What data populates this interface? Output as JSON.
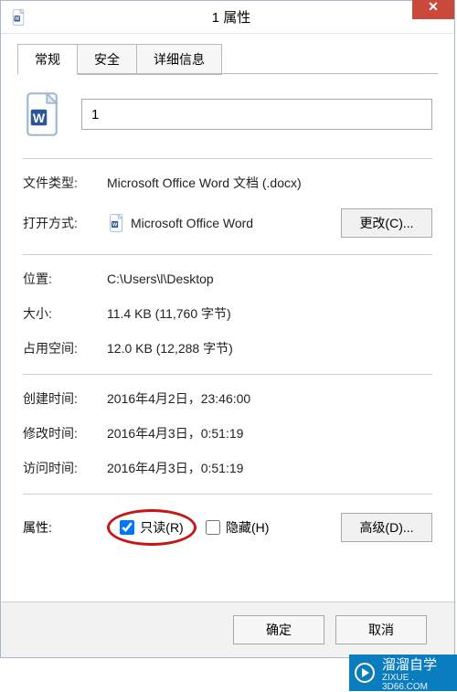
{
  "window": {
    "title": "1 属性",
    "close_icon_label": "✕"
  },
  "tabs": [
    {
      "label": "常规"
    },
    {
      "label": "安全"
    },
    {
      "label": "详细信息"
    }
  ],
  "general": {
    "filename": "1",
    "file_type_label": "文件类型:",
    "file_type": "Microsoft Office Word 文档 (.docx)",
    "opens_with_label": "打开方式:",
    "opens_with": "Microsoft Office Word",
    "change_button": "更改(C)...",
    "location_label": "位置:",
    "location": "C:\\Users\\l\\Desktop",
    "size_label": "大小:",
    "size": "11.4 KB (11,760 字节)",
    "size_on_disk_label": "占用空间:",
    "size_on_disk": "12.0 KB (12,288 字节)",
    "created_label": "创建时间:",
    "created": "2016年4月2日，23:46:00",
    "modified_label": "修改时间:",
    "modified": "2016年4月3日，0:51:19",
    "accessed_label": "访问时间:",
    "accessed": "2016年4月3日，0:51:19",
    "attributes_label": "属性:",
    "readonly_label": "只读(R)",
    "readonly_checked": true,
    "hidden_label": "隐藏(H)",
    "hidden_checked": false,
    "advanced_button": "高级(D)..."
  },
  "footer": {
    "ok": "确定",
    "cancel": "取消"
  },
  "watermark": {
    "brand": "溜溜自学",
    "sub": "ZIXUE . 3D66.COM"
  }
}
